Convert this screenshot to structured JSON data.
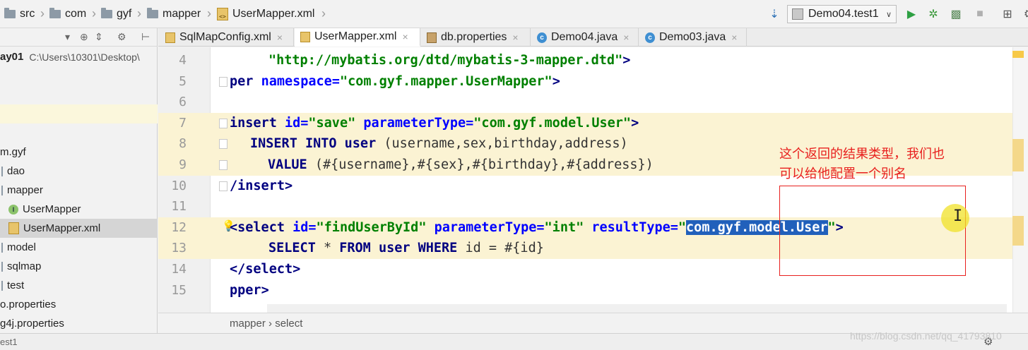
{
  "navbar": {
    "crumbs": [
      "src",
      "com",
      "gyf",
      "mapper",
      "UserMapper.xml"
    ],
    "run_config": "Demo04.test1"
  },
  "project": {
    "root_name": "ay01",
    "root_path": "C:\\Users\\10301\\Desktop\\",
    "items": [
      {
        "label": "m.gyf",
        "icon": "none"
      },
      {
        "label": "dao",
        "icon": "package-icon"
      },
      {
        "label": "mapper",
        "icon": "package-icon"
      },
      {
        "label": "UserMapper",
        "icon": "interface-icon"
      },
      {
        "label": "UserMapper.xml",
        "icon": "xml-file-icon"
      },
      {
        "label": "model",
        "icon": "package-icon"
      },
      {
        "label": "sqlmap",
        "icon": "package-icon"
      },
      {
        "label": "test",
        "icon": "package-icon"
      },
      {
        "label": "o.properties",
        "icon": "none"
      },
      {
        "label": "g4j.properties",
        "icon": "none"
      }
    ]
  },
  "tabs": [
    {
      "label": "SqlMapConfig.xml",
      "icon": "xml-file-icon"
    },
    {
      "label": "UserMapper.xml",
      "icon": "xml-file-icon"
    },
    {
      "label": "db.properties",
      "icon": "properties-file-icon"
    },
    {
      "label": "Demo04.java",
      "icon": "java-class-icon"
    },
    {
      "label": "Demo03.java",
      "icon": "java-class-icon"
    }
  ],
  "editor": {
    "line_numbers": [
      "4",
      "5",
      "6",
      "7",
      "8",
      "9",
      "10",
      "11",
      "12",
      "13",
      "14",
      "15"
    ],
    "l4": {
      "s1": "\"http://mybatis.org/dtd/mybatis-3-mapper.dtd\"",
      "t1": ">"
    },
    "l5": {
      "t1": "per ",
      "a1": "namespace=",
      "s1": "\"com.gyf.mapper.UserMapper\"",
      "t2": ">"
    },
    "l7": {
      "t1": "insert ",
      "a1": "id=",
      "s1": "\"save\"",
      "a2": " parameterType=",
      "s2": "\"com.gyf.model.User\"",
      "t2": ">"
    },
    "l8": {
      "k1": "INSERT INTO user",
      "x1": " (username,sex,birthday,address)"
    },
    "l9": {
      "k1": "VALUE",
      "x1": " (#{username},#{sex},#{birthday},#{address})"
    },
    "l10": {
      "t1": "/insert",
      "t2": ">"
    },
    "l12": {
      "t1": "<select ",
      "a1": "id=",
      "s1": "\"findUserById\"",
      "a2": " parameterType=",
      "s2": "\"int\"",
      "a3": " resultType=",
      "s3": "\"",
      "sel": "com.gyf.model.User",
      "s4": "\"",
      "t2": ">"
    },
    "l13": {
      "k1": "SELECT",
      "x1": " * ",
      "k2": "FROM user WHERE",
      "x2": " id = #{id}"
    },
    "l14": {
      "t1": "</select",
      "t2": ">"
    },
    "l15": {
      "t1": "pper",
      "t2": ">"
    }
  },
  "breadcrumb": {
    "path": "mapper › select"
  },
  "status": {
    "left": "est1"
  },
  "annotation": {
    "line1": "这个返回的结果类型，我们也",
    "line2": "可以给他配置一个别名"
  },
  "watermark": "https://blog.csdn.net/qq_41793810",
  "colors": {
    "annotation": "#e8201e",
    "selection": "#2160bb",
    "highlight_line": "#fbf3d3"
  }
}
